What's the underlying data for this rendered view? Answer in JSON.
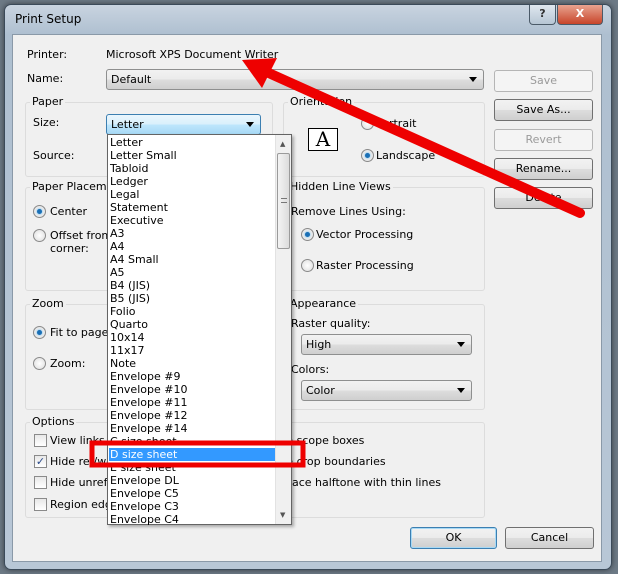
{
  "window": {
    "title": "Print Setup",
    "help_label": "?",
    "close_label": "X"
  },
  "printer": {
    "label": "Printer:",
    "value": "Microsoft XPS Document Writer"
  },
  "name": {
    "label": "Name:",
    "value": "Default"
  },
  "paper": {
    "group": "Paper",
    "size_label": "Size:",
    "size_value": "Letter",
    "source_label": "Source:"
  },
  "orientation": {
    "group": "Orientation",
    "portrait": "Portrait",
    "landscape": "Landscape",
    "selected": "Landscape",
    "icon_letter": "A"
  },
  "buttons": {
    "save": "Save",
    "save_as": "Save As...",
    "revert": "Revert",
    "rename": "Rename...",
    "delete": "Delete",
    "ok": "OK",
    "cancel": "Cancel"
  },
  "placement": {
    "group": "Paper Placement",
    "center": "Center",
    "offset": "Offset from",
    "corner": "corner:",
    "selected": "Center"
  },
  "hidden_lines": {
    "group": "Hidden Line Views",
    "remove_label": "Remove Lines Using:",
    "vector": "Vector Processing",
    "raster": "Raster Processing",
    "selected": "Vector Processing"
  },
  "zoom": {
    "group": "Zoom",
    "fit": "Fit to page",
    "zoom": "Zoom:",
    "selected": "Fit to page"
  },
  "appearance": {
    "group": "Appearance",
    "raster_label": "Raster quality:",
    "raster_value": "High",
    "colors_label": "Colors:",
    "colors_value": "Color"
  },
  "options": {
    "group": "Options",
    "items": [
      {
        "label": "View links in",
        "checked": false
      },
      {
        "label": "Hide ref/work planes",
        "checked": true
      },
      {
        "label": "Hide unreferenced view tags",
        "checked": false
      },
      {
        "label": "Region edges mask coincident lines",
        "checked": false
      }
    ],
    "right_items": [
      "Hide scope boxes",
      "Hide crop boundaries",
      "Replace halftone with thin lines"
    ]
  },
  "size_list": {
    "selected": "D size sheet",
    "items": [
      "Letter",
      "Letter Small",
      "Tabloid",
      "Ledger",
      "Legal",
      "Statement",
      "Executive",
      "A3",
      "A4",
      "A4 Small",
      "A5",
      "B4 (JIS)",
      "B5 (JIS)",
      "Folio",
      "Quarto",
      "10x14",
      "11x17",
      "Note",
      "Envelope #9",
      "Envelope #10",
      "Envelope #11",
      "Envelope #12",
      "Envelope #14",
      "C size sheet",
      "D size sheet",
      "E size sheet",
      "Envelope DL",
      "Envelope C5",
      "Envelope C3",
      "Envelope C4"
    ]
  },
  "annotation_color": "#ee0000"
}
